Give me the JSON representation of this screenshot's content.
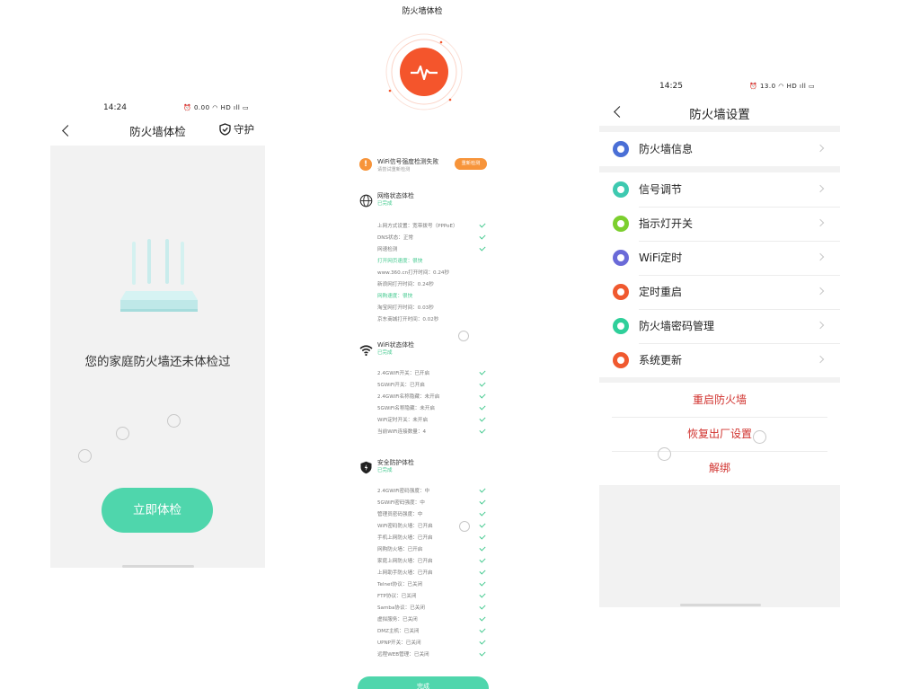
{
  "screen1": {
    "status_time": "14:24",
    "status_icons": "⏰ 0.00 ◠ HD ıll ▭",
    "title": "防火墙体检",
    "guard_label": "守护",
    "empty_text": "您的家庭防火墙还未体检过",
    "cta_label": "立即体检"
  },
  "screen2": {
    "title": "防火墙体检",
    "alert": {
      "title": "WiFi信号强度检测失败",
      "subtitle": "请尝试重新检测",
      "button": "重新检测"
    },
    "sections": [
      {
        "title": "网络状态体检",
        "status": "已完成",
        "items": [
          {
            "text": "上网方式设置：宽带拨号（PPPoE）",
            "highlight": false,
            "check": true
          },
          {
            "text": "DNS状态：正常",
            "highlight": false,
            "check": true
          },
          {
            "text": "网速检测",
            "highlight": false,
            "check": true
          },
          {
            "text": "打开网页速度：很快",
            "highlight": true,
            "check": false
          },
          {
            "text": "www.360.cn打开时间：0.24秒",
            "highlight": false,
            "check": false
          },
          {
            "text": "新浪网打开时间：0.24秒",
            "highlight": false,
            "check": false
          },
          {
            "text": "网购速度：很快",
            "highlight": true,
            "check": false
          },
          {
            "text": "淘宝网打开时间：0.03秒",
            "highlight": false,
            "check": false
          },
          {
            "text": "京东商城打开时间：0.02秒",
            "highlight": false,
            "check": false
          }
        ]
      },
      {
        "title": "WiFi状态体检",
        "status": "已完成",
        "items": [
          {
            "text": "2.4GWiFi开关：已开启",
            "highlight": false,
            "check": true
          },
          {
            "text": "5GWiFi开关：已开启",
            "highlight": false,
            "check": true
          },
          {
            "text": "2.4GWiFi名称隐藏：未开启",
            "highlight": false,
            "check": true
          },
          {
            "text": "5GWiFi名称隐藏：未开启",
            "highlight": false,
            "check": true
          },
          {
            "text": "WiFi定时开关：未开启",
            "highlight": false,
            "check": true
          },
          {
            "text": "当前WiFi连接数量：4",
            "highlight": false,
            "check": true
          }
        ]
      },
      {
        "title": "安全防护体检",
        "status": "已完成",
        "items": [
          {
            "text": "2.4GWiFi密码强度：中",
            "highlight": false,
            "check": true
          },
          {
            "text": "5GWiFi密码强度：中",
            "highlight": false,
            "check": true
          },
          {
            "text": "管理员密码强度：中",
            "highlight": false,
            "check": true
          },
          {
            "text": "WiFi密码防火墙：已开启",
            "highlight": false,
            "check": true
          },
          {
            "text": "手机上网防火墙：已开启",
            "highlight": false,
            "check": true
          },
          {
            "text": "网购防火墙：已开启",
            "highlight": false,
            "check": true
          },
          {
            "text": "家庭上网防火墙：已开启",
            "highlight": false,
            "check": true
          },
          {
            "text": "上网助手防火墙：已开启",
            "highlight": false,
            "check": true
          },
          {
            "text": "Telnet协议：已关闭",
            "highlight": false,
            "check": true
          },
          {
            "text": "FTP协议：已关闭",
            "highlight": false,
            "check": true
          },
          {
            "text": "Samba协议：已关闭",
            "highlight": false,
            "check": true
          },
          {
            "text": "虚拟服务：已关闭",
            "highlight": false,
            "check": true
          },
          {
            "text": "DMZ主机：已关闭",
            "highlight": false,
            "check": true
          },
          {
            "text": "UPNP开关：已关闭",
            "highlight": false,
            "check": true
          },
          {
            "text": "远程WEB管理：已关闭",
            "highlight": false,
            "check": true
          }
        ]
      }
    ],
    "done_label": "完成"
  },
  "screen3": {
    "status_time": "14:25",
    "status_icons": "⏰ 13.0 ◠ HD ıll ▭",
    "title": "防火墙设置",
    "group1": [
      {
        "label": "防火墙信息",
        "icon": "firewall-info-icon",
        "color": "#4a6fd6"
      }
    ],
    "group2": [
      {
        "label": "信号调节",
        "icon": "signal-icon",
        "color": "#3ec9b0"
      },
      {
        "label": "指示灯开关",
        "icon": "indicator-light-icon",
        "color": "#7ccf2e"
      },
      {
        "label": "WiFi定时",
        "icon": "hourglass-icon",
        "color": "#6a6ad8"
      },
      {
        "label": "定时重启",
        "icon": "power-icon",
        "color": "#f0592f"
      },
      {
        "label": "防火墙密码管理",
        "icon": "lock-icon",
        "color": "#2fcf9a"
      },
      {
        "label": "系统更新",
        "icon": "update-icon",
        "color": "#f0592f"
      }
    ],
    "actions": [
      "重启防火墙",
      "恢复出厂设置",
      "解绑"
    ]
  }
}
